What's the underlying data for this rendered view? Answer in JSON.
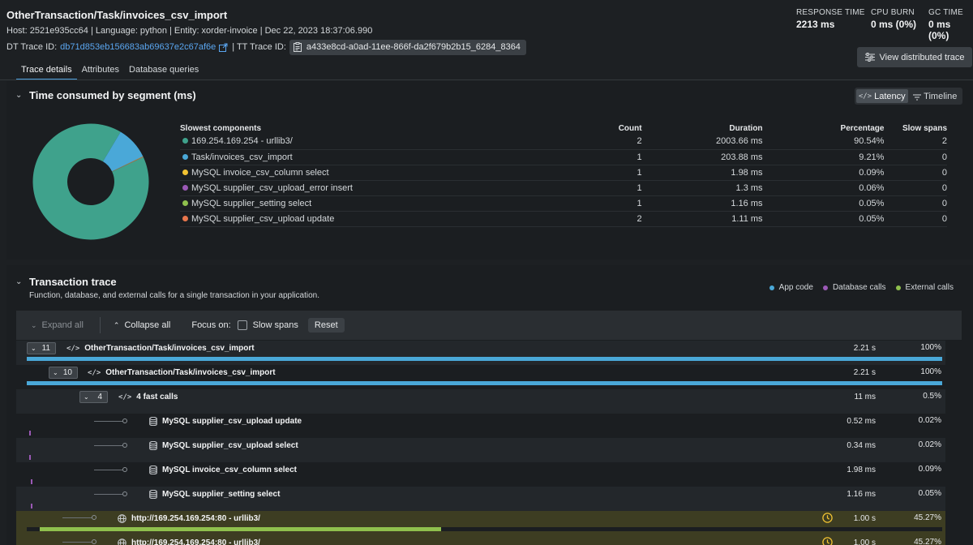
{
  "header": {
    "title": "OtherTransaction/Task/invoices_csv_import",
    "meta_line": "Host: 2521e935cc64 | Language: python | Entity: xorder-invoice | Dec 22, 2023 18:37:06.990",
    "dt_label": "DT Trace ID:",
    "dt_value": "db71d853eb156683ab69637e2c67af6e",
    "tt_label": "| TT Trace ID:",
    "tt_value": "a433e8cd-a0ad-11ee-866f-da2f679b2b15_6284_8364",
    "metrics": [
      {
        "label": "RESPONSE TIME",
        "value": "2213 ms"
      },
      {
        "label": "CPU BURN",
        "value": "0 ms (0%)"
      },
      {
        "label": "GC TIME",
        "value": "0 ms (0%)"
      }
    ],
    "view_distributed": "View distributed trace"
  },
  "tabs": [
    "Trace details",
    "Attributes",
    "Database queries"
  ],
  "segments": {
    "title": "Time consumed by segment (ms)",
    "toggle": {
      "latency": "Latency",
      "timeline": "Timeline"
    },
    "columns": [
      "Slowest components",
      "Count",
      "Duration",
      "Percentage",
      "Slow spans"
    ],
    "rows": [
      {
        "name": "169.254.169.254 - urllib3/",
        "count": "2",
        "duration": "2003.66 ms",
        "percentage": "90.54%",
        "slow": "2",
        "color": "#3fa28c",
        "share": 90.54
      },
      {
        "name": "Task/invoices_csv_import",
        "count": "1",
        "duration": "203.88 ms",
        "percentage": "9.21%",
        "slow": "0",
        "color": "#4aa8d8",
        "share": 9.21
      },
      {
        "name": "MySQL invoice_csv_column select",
        "count": "1",
        "duration": "1.98 ms",
        "percentage": "0.09%",
        "slow": "0",
        "color": "#f1c232",
        "share": 0.09
      },
      {
        "name": "MySQL supplier_csv_upload_error insert",
        "count": "1",
        "duration": "1.3 ms",
        "percentage": "0.06%",
        "slow": "0",
        "color": "#9b59b6",
        "share": 0.06
      },
      {
        "name": "MySQL supplier_setting select",
        "count": "1",
        "duration": "1.16 ms",
        "percentage": "0.05%",
        "slow": "0",
        "color": "#8fc04d",
        "share": 0.05
      },
      {
        "name": "MySQL supplier_csv_upload update",
        "count": "2",
        "duration": "1.11 ms",
        "percentage": "0.05%",
        "slow": "0",
        "color": "#e8764c",
        "share": 0.05
      }
    ]
  },
  "transaction": {
    "title": "Transaction trace",
    "subtitle": "Function, database, and external calls for a single transaction in your application.",
    "legend": [
      {
        "label": "App code",
        "color": "#4aa8d8"
      },
      {
        "label": "Database calls",
        "color": "#9b59b6"
      },
      {
        "label": "External calls",
        "color": "#8fc04d"
      }
    ],
    "toolbar": {
      "expand_all": "Expand all",
      "collapse_all": "Collapse all",
      "focus_on": "Focus on:",
      "slow_spans": "Slow spans",
      "reset": "Reset"
    },
    "rows": [
      {
        "count": "11",
        "name": "OtherTransaction/Task/invoices_csv_import",
        "duration": "2.21 s",
        "percent": "100%",
        "fill": 1.0
      },
      {
        "count": "10",
        "name": "OtherTransaction/Task/invoices_csv_import",
        "duration": "2.21 s",
        "percent": "100%",
        "fill": 1.0
      },
      {
        "count": "4",
        "name": "4 fast calls",
        "duration": "11 ms",
        "percent": "0.5%"
      },
      {
        "name": "MySQL supplier_csv_upload update",
        "duration": "0.52 ms",
        "percent": "0.02%"
      },
      {
        "name": "MySQL supplier_csv_upload select",
        "duration": "0.34 ms",
        "percent": "0.02%"
      },
      {
        "name": "MySQL invoice_csv_column select",
        "duration": "1.98 ms",
        "percent": "0.09%"
      },
      {
        "name": "MySQL supplier_setting select",
        "duration": "1.16 ms",
        "percent": "0.05%"
      },
      {
        "name": "http://169.254.169.254:80 - urllib3/",
        "duration": "1.00 s",
        "percent": "45.27%",
        "fill": 0.4527
      },
      {
        "name": "http://169.254.169.254:80 - urllib3/",
        "duration": "1.00 s",
        "percent": "45.27%"
      }
    ]
  }
}
